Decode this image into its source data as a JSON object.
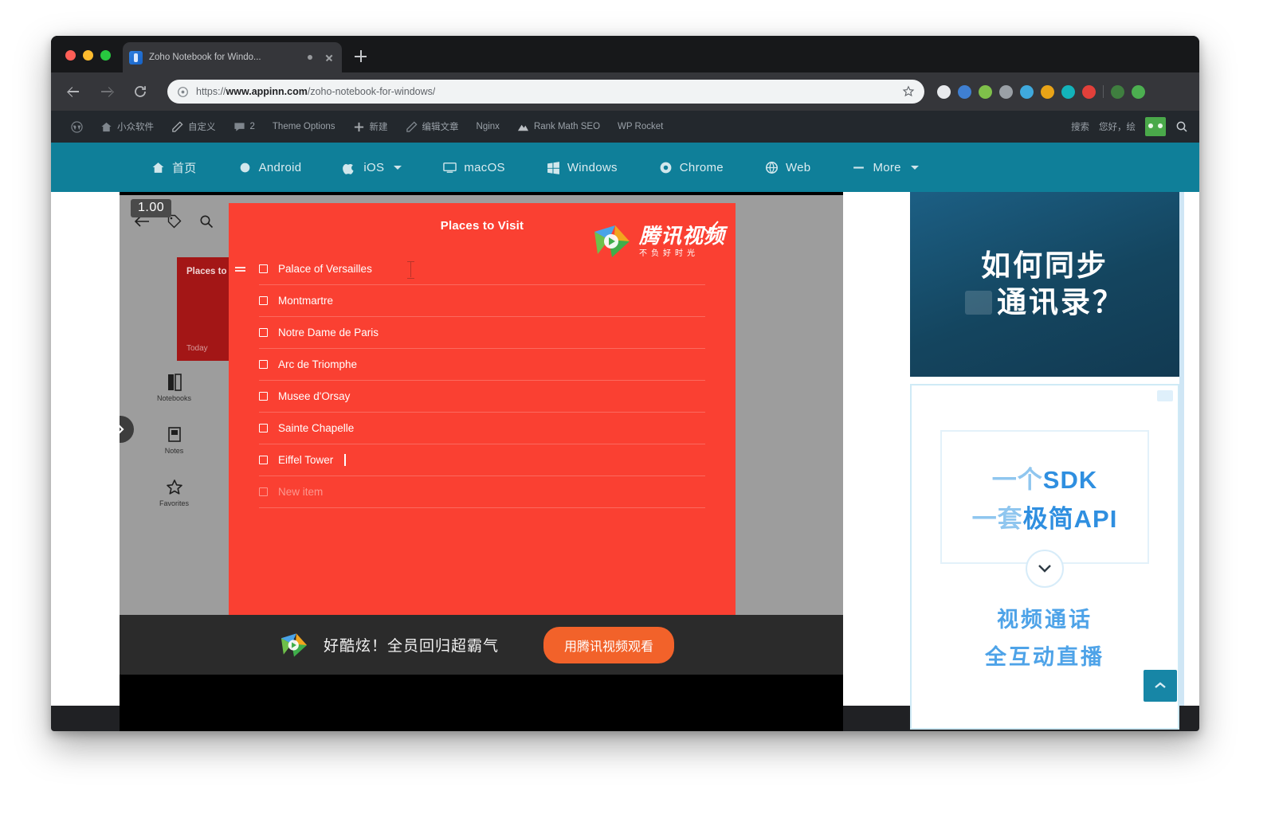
{
  "browser": {
    "tab": {
      "title": "Zoho Notebook for Windo...",
      "favicon_name": "zoho-favicon",
      "audio_icon": "audio-indicator-icon",
      "close_icon": "close-icon"
    },
    "new_tab_label": "new-tab-icon",
    "nav": {
      "back": "back-arrow-icon",
      "forward": "forward-arrow-icon",
      "reload": "reload-icon"
    },
    "omnibox": {
      "prefix": "https://",
      "host": "www.appinn.com",
      "path": "/zoho-notebook-for-windows/",
      "lock_icon": "info-circle-icon",
      "star_icon": "bookmark-star-icon"
    },
    "extensions": [
      {
        "name": "ext-blue",
        "color": "#3f7fd1"
      },
      {
        "name": "ext-green-orange",
        "color": "#7fc04a"
      },
      {
        "name": "ext-gray",
        "color": "#9aa0a6"
      },
      {
        "name": "ext-diamond",
        "color": "#3fa9dd"
      },
      {
        "name": "ext-colorful",
        "color": "#e8a317"
      },
      {
        "name": "ext-teal",
        "color": "#13b3ba"
      },
      {
        "name": "ext-red",
        "color": "#e2403a"
      },
      {
        "name": "ext-profile",
        "color": "#3f7e3f"
      },
      {
        "name": "ext-menu",
        "color": "#4caf50"
      }
    ]
  },
  "adminbar": {
    "items": [
      {
        "label": "",
        "icon": "wordpress-icon"
      },
      {
        "label": "小众软件",
        "icon": "home-icon"
      },
      {
        "label": "自定义",
        "icon": "pencil-icon"
      },
      {
        "label": "2",
        "icon": "comment-icon"
      },
      {
        "label": "Theme Options",
        "icon": ""
      },
      {
        "label": "新建",
        "icon": "plus-icon"
      },
      {
        "label": "编辑文章",
        "icon": "edit-icon"
      },
      {
        "label": "Nginx",
        "icon": ""
      },
      {
        "label": "Rank Math SEO",
        "icon": "rankmath-icon"
      },
      {
        "label": "WP Rocket",
        "icon": ""
      }
    ],
    "right": [
      {
        "label": "搜索",
        "icon": "search-icon"
      },
      {
        "label": "您好，绘",
        "icon": ""
      }
    ],
    "avatar_name": "user-avatar"
  },
  "sitenav": {
    "items": [
      {
        "label": "首页",
        "icon": "home-icon",
        "caret": false
      },
      {
        "label": "Android",
        "icon": "android-icon",
        "caret": false
      },
      {
        "label": "iOS",
        "icon": "apple-icon",
        "caret": true
      },
      {
        "label": "macOS",
        "icon": "monitor-icon",
        "caret": false
      },
      {
        "label": "Windows",
        "icon": "windows-icon",
        "caret": false
      },
      {
        "label": "Chrome",
        "icon": "chrome-icon",
        "caret": false
      },
      {
        "label": "Web",
        "icon": "globe-icon",
        "caret": false
      },
      {
        "label": "More",
        "icon": "dash-icon",
        "caret": true
      }
    ]
  },
  "app": {
    "zoom_badge": "1.00",
    "toolbar": {
      "back_icon": "back-arrow-icon",
      "tag_icon": "tag-icon",
      "search_icon": "search-icon"
    },
    "rail": [
      {
        "label": "Notebooks",
        "icon": "notebooks-icon"
      },
      {
        "label": "Notes",
        "icon": "notes-icon"
      },
      {
        "label": "Favorites",
        "icon": "star-icon"
      }
    ],
    "rail_expand_icon": "chevron-right-icon",
    "sync_icon": "sync-icon",
    "note_card": {
      "title": "Places to Visit",
      "date": "Today"
    },
    "editor_tools": [
      {
        "name": "camera-icon"
      },
      {
        "name": "checklist-icon"
      },
      {
        "name": "attachment-icon"
      }
    ],
    "avatar_name": "account-avatar",
    "note": {
      "title": "Places to Visit",
      "done_icon": "checkmark-icon",
      "drag_handle_icon": "drag-handle-icon",
      "text_cursor_icon": "i-beam-cursor",
      "bottom_icon": "color-palette-icon",
      "items": [
        {
          "label": "Palace of Versailles",
          "checked": false,
          "editing": false
        },
        {
          "label": "Montmartre",
          "checked": false,
          "editing": false
        },
        {
          "label": "Notre Dame de Paris",
          "checked": false,
          "editing": false
        },
        {
          "label": "Arc de Triomphe",
          "checked": false,
          "editing": false
        },
        {
          "label": "Musee d'Orsay",
          "checked": false,
          "editing": false
        },
        {
          "label": "Sainte Chapelle",
          "checked": false,
          "editing": false
        },
        {
          "label": "Eiffel Tower",
          "checked": false,
          "editing": true
        }
      ],
      "new_item_placeholder": "New item"
    }
  },
  "tencent_overlay": {
    "logo_name": "tencent-video-logo",
    "title": "腾讯视频",
    "slogan": "不负好时光"
  },
  "shot_banner": {
    "logo_name": "tencent-video-logo",
    "text": "好酷炫！全员回归超霸气",
    "button_label": "用腾讯视频观看"
  },
  "ads": {
    "top": {
      "line1": "如何同步",
      "line2": "通讯录？"
    },
    "bottom": {
      "sdk_line1_light": "一个",
      "sdk_line1_bold": "SDK",
      "sdk_line2_light": "一套",
      "sdk_line2_bold": "极简API",
      "chevron_icon": "chevron-down-icon",
      "line1": "视频通话",
      "line2": "全互动直播",
      "mini_icon": "window-control-icon"
    }
  },
  "scroll_top": {
    "icon": "chevron-up-icon"
  },
  "colors": {
    "note_red": "#fa4032",
    "nav_teal": "#0f7f99",
    "banner_orange": "#f2622a",
    "admin_dark": "#23282d"
  }
}
